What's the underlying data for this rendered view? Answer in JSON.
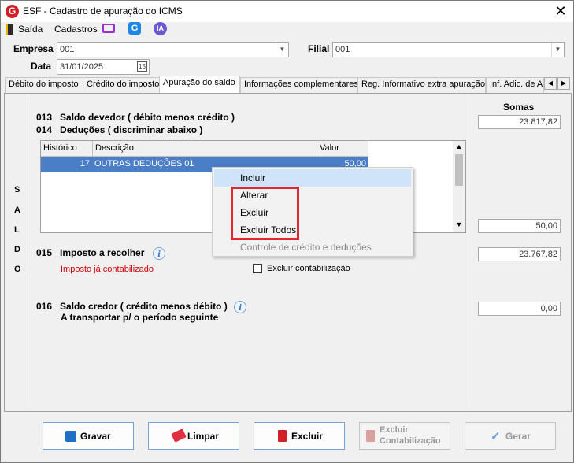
{
  "window": {
    "title": "ESF - Cadastro de apuração do ICMS"
  },
  "menu": {
    "saida": "Saída",
    "cadastros": "Cadastros",
    "ia": "IA"
  },
  "header": {
    "empresa_label": "Empresa",
    "empresa_value": "001",
    "filial_label": "Filial",
    "filial_value": "001",
    "data_label": "Data",
    "data_value": "31/01/2025",
    "cal_icon": "15"
  },
  "tabs": [
    {
      "label": "Débito do imposto"
    },
    {
      "label": "Crédito do imposto"
    },
    {
      "label": "Apuração do saldo"
    },
    {
      "label": "Informações complementares"
    },
    {
      "label": "Reg. Informativo extra apuração"
    },
    {
      "label": "Inf. Adic. de A"
    }
  ],
  "side_label": [
    "S",
    "A",
    "L",
    "D",
    "O"
  ],
  "sections": {
    "s013": "013   Saldo devedor ( débito menos crédito )",
    "s014": "014   Deduções ( discriminar abaixo )",
    "s015": "015   Imposto a recolher",
    "s015_status": "Imposto já contabilizado",
    "s015_checkbox": "Excluir contabilização",
    "s016": "016   Saldo credor ( crédito menos débito )",
    "s016_sub": "A transportar p/ o período seguinte"
  },
  "grid": {
    "columns": [
      "Histórico",
      "Descrição",
      "Valor"
    ],
    "rows": [
      {
        "historico": "17",
        "descricao": "OUTRAS DEDUÇÕES 01",
        "valor": "50,00"
      }
    ]
  },
  "somas": {
    "header": "Somas",
    "v013": "23.817,82",
    "v014": "50,00",
    "v015": "23.767,82",
    "v016": "0,00"
  },
  "context_menu": {
    "items": [
      "Incluir",
      "Alterar",
      "Excluir",
      "Excluir Todos",
      "Controle de crédito e deduções"
    ]
  },
  "buttons": {
    "gravar": "Gravar",
    "limpar": "Limpar",
    "excluir": "Excluir",
    "excluir_contab_1": "Excluir",
    "excluir_contab_2": "Contabilização",
    "gerar": "Gerar"
  },
  "colors": {
    "selection": "#4a7fc7",
    "highlight_box": "#e3262d",
    "menu_hover": "#cfe4f8",
    "status_red": "#d00000"
  }
}
